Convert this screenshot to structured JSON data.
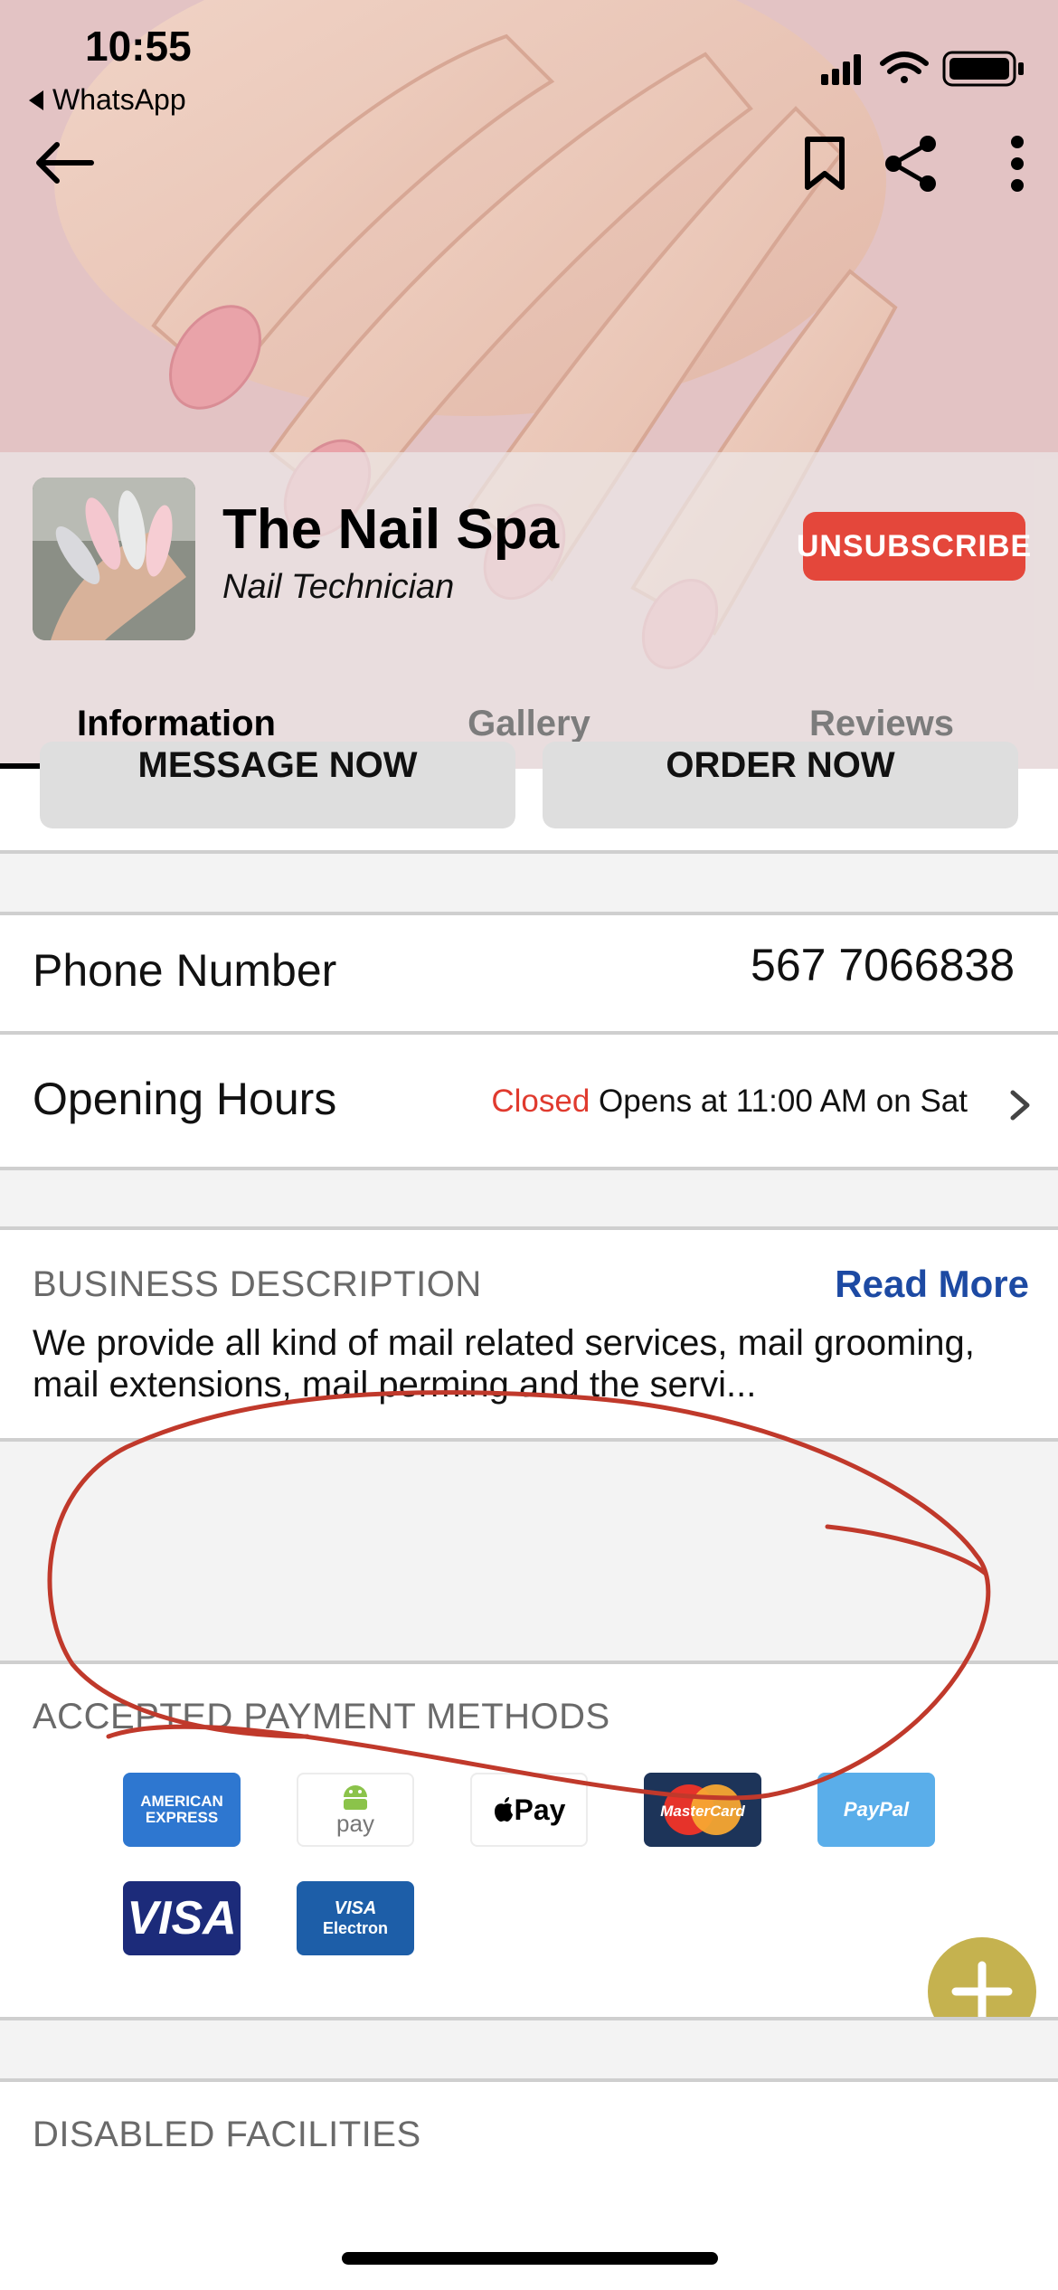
{
  "status_bar": {
    "time": "10:55",
    "back_app": "WhatsApp"
  },
  "header": {
    "icons": [
      "back-arrow-icon",
      "bookmark-icon",
      "share-icon",
      "more-vertical-icon"
    ],
    "business_name": "The Nail Spa",
    "category": "Nail Technician",
    "unsubscribe_label": "UNSUBSCRIBE",
    "accent_color": "#e4473b"
  },
  "tabs": [
    {
      "label": "Information",
      "active": true
    },
    {
      "label": "Gallery",
      "active": false
    },
    {
      "label": "Reviews",
      "active": false
    }
  ],
  "actions": {
    "message_label": "MESSAGE NOW",
    "order_label": "ORDER NOW"
  },
  "details": {
    "phone_label": "Phone Number",
    "phone_value": "567 7066838",
    "hours_label": "Opening Hours",
    "hours_status": "Closed",
    "hours_next": "Opens at 11:00 AM on Sat"
  },
  "description": {
    "heading": "BUSINESS DESCRIPTION",
    "read_more": "Read More",
    "text": "We provide all kind of mail related services, mail grooming, mail extensions, mail perming and the servi..."
  },
  "payments": {
    "heading": "ACCEPTED PAYMENT METHODS",
    "amex_text": "AMERICAN EXPRESS",
    "android_pay_text": "pay",
    "apple_pay_text": "Pay",
    "mastercard_text": "MasterCard",
    "paypal_text": "PayPal",
    "visa_text": "VISA",
    "visa_electron_top": "VISA",
    "visa_electron_bottom": "Electron"
  },
  "facilities": {
    "heading": "DISABLED FACILITIES"
  },
  "fab": {
    "icon": "plus-icon",
    "color": "#c5b24f"
  },
  "annotation_color": "#c0392b"
}
